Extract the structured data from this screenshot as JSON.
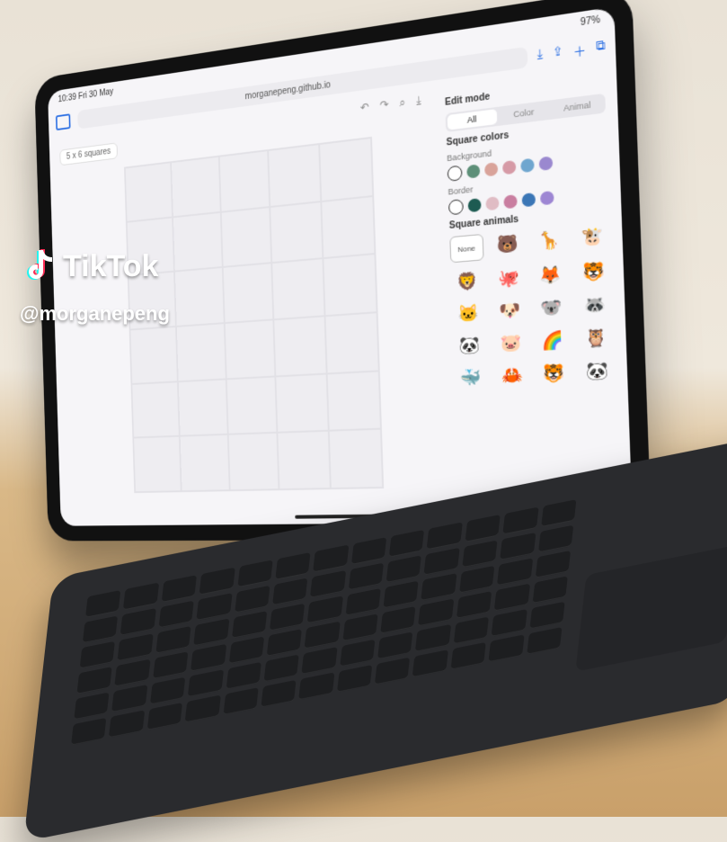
{
  "status": {
    "time": "10:39  Fri 30 May",
    "battery": "97%"
  },
  "browser": {
    "url": "morganepeng.github.io",
    "tab_dots": "•••"
  },
  "main": {
    "grid_select": "5 x 6 squares",
    "rows": 6,
    "cols": 5
  },
  "panel": {
    "edit_mode_title": "Edit mode",
    "edit_mode_options": [
      {
        "label": "All",
        "selected": true
      },
      {
        "label": "Color",
        "selected": false
      },
      {
        "label": "Animal",
        "selected": false
      }
    ],
    "square_colors_title": "Square colors",
    "background_label": "Background",
    "background_colors": [
      "#5d8f78",
      "#d9a39a",
      "#d69aa6",
      "#6fa6cf",
      "#9a88cf"
    ],
    "border_label": "Border",
    "border_colors": [
      "#1d5b52",
      "#e0bcc4",
      "#c97ea0",
      "#3b76b6",
      "#9d86d3"
    ],
    "square_animals_title": "Square animals",
    "none_label": "None",
    "animals": [
      "🐻",
      "🦒",
      "🐮",
      "🦁",
      "🐙",
      "🦊",
      "🐯",
      "🐱",
      "🐶",
      "🐨",
      "🦝",
      "🐼",
      "🐷",
      "🌈",
      "🦉",
      "🐳",
      "🦀",
      "🐯",
      "🐼"
    ]
  },
  "watermark": {
    "brand": "TikTok",
    "handle": "@morganepeng"
  }
}
